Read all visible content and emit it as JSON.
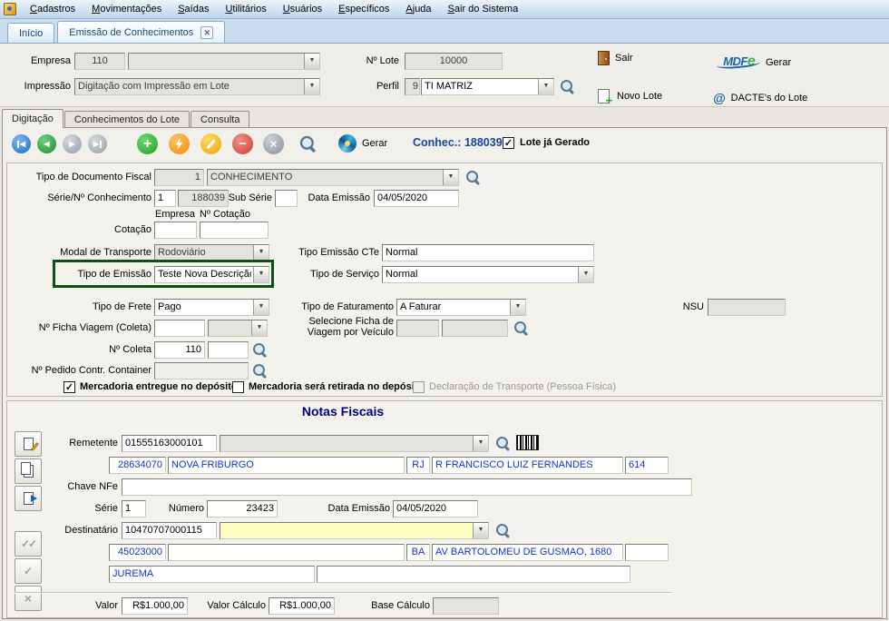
{
  "menubar": {
    "items": [
      "Cadastros",
      "Movimentações",
      "Saídas",
      "Utilitários",
      "Usuários",
      "Específicos",
      "Ajuda",
      "Sair do Sistema"
    ]
  },
  "tabs": {
    "inicio": "Início",
    "emissao": "Emissão de Conhecimentos"
  },
  "header": {
    "empresa_label": "Empresa",
    "empresa_value": "110",
    "impressao_label": "Impressão",
    "impressao_value": "Digitação com Impressão em Lote",
    "lote_label": "Nº Lote",
    "lote_value": "10000",
    "perfil_label": "Perfil",
    "perfil_code": "9",
    "perfil_value": "TI MATRIZ",
    "sair_label": "Sair",
    "novo_lote_label": "Novo Lote",
    "gerar_label": "Gerar",
    "dacte_label": "DACTE's do Lote",
    "logo_mdf": "MDF",
    "logo_e": "e"
  },
  "subtabs": {
    "digitacao": "Digitação",
    "conhecimentos": "Conhecimentos do Lote",
    "consulta": "Consulta"
  },
  "toolbar": {
    "gerar_label": "Gerar",
    "conhec_label": "Conhec.: 188039",
    "lote_gerado_label": "Lote já Gerado",
    "lote_gerado_checked": true
  },
  "form": {
    "tipo_doc_label": "Tipo de Documento Fiscal",
    "tipo_doc_code": "1",
    "tipo_doc_value": "CONHECIMENTO",
    "serie_label": "Série/Nº Conhecimento",
    "serie_value": "1",
    "conhecimento_numero": "188039",
    "subserie_label": "Sub Série",
    "subserie_value": "",
    "data_emissao_label": "Data Emissão",
    "data_emissao_value": "04/05/2020",
    "empresa_col_label": "Empresa",
    "cotacao_col_label": "Nº Cotação",
    "cotacao_label": "Cotação",
    "cotacao_v1": "",
    "cotacao_v2": "",
    "modal_label": "Modal de Transporte",
    "modal_value": "Rodoviário",
    "emissao_cte_label": "Tipo Emissão CTe",
    "emissao_cte_value": "Normal",
    "tipo_emissao_label": "Tipo de Emissão",
    "tipo_emissao_value": "Teste Nova Descrição",
    "tipo_servico_label": "Tipo de Serviço",
    "tipo_servico_value": "Normal",
    "tipo_frete_label": "Tipo de Frete",
    "tipo_frete_value": "Pago",
    "tipo_faturamento_label": "Tipo de Faturamento",
    "tipo_faturamento_value": "A Faturar",
    "nsu_label": "NSU",
    "nsu_value": "",
    "ficha_viagem_label": "Nº Ficha Viagem (Coleta)",
    "ficha_viagem_v1": "",
    "ficha_viagem_v2": "",
    "selecione_ficha_label": "Selecione Ficha de Viagem por Veículo",
    "selecione_ficha_v1": "",
    "selecione_ficha_v2": "",
    "coleta_label": "Nº Coleta",
    "coleta_value": "110",
    "coleta_v2": "",
    "pedido_container_label": "Nº Pedido Contr. Container",
    "pedido_container_value": "",
    "checks": [
      {
        "label": "Mercadoria entregue no depósito",
        "checked": true
      },
      {
        "label": "Mercadoria será retirada no depósito",
        "checked": false
      },
      {
        "label": "Declaração de Transporte (Pessoa Física)",
        "checked": false
      }
    ]
  },
  "notas": {
    "title": "Notas Fiscais",
    "remetente_label": "Remetente",
    "remetente_cnpj": "01555163000101",
    "remetente_nome": "",
    "rem_cep": "28634070",
    "rem_cidade": "NOVA FRIBURGO",
    "rem_uf": "RJ",
    "rem_endereco": "R FRANCISCO LUIZ FERNANDES",
    "rem_numero": "614",
    "chave_label": "Chave NFe",
    "chave_value": "",
    "serie_label": "Série",
    "serie_value": "1",
    "numero_label": "Número",
    "numero_value": "23423",
    "data_emissao_label": "Data Emissão",
    "data_emissao_value": "04/05/2020",
    "destinatario_label": "Destinatário",
    "destinatario_cnpj": "10470707000115",
    "destinatario_nome": "",
    "dest_cep": "45023000",
    "dest_cidade": "",
    "dest_uf": "BA",
    "dest_endereco": "AV BARTOLOMEU DE GUSMAO, 1680",
    "dest_numero": "",
    "bairro_value": "JUREMA",
    "complemento_value": "",
    "valor_label": "Valor",
    "valor_value": "R$1.000,00",
    "valor_calculo_label": "Valor Cálculo",
    "valor_calculo_value": "R$1.000,00",
    "base_calculo_label": "Base Cálculo",
    "base_calculo_value": ""
  }
}
